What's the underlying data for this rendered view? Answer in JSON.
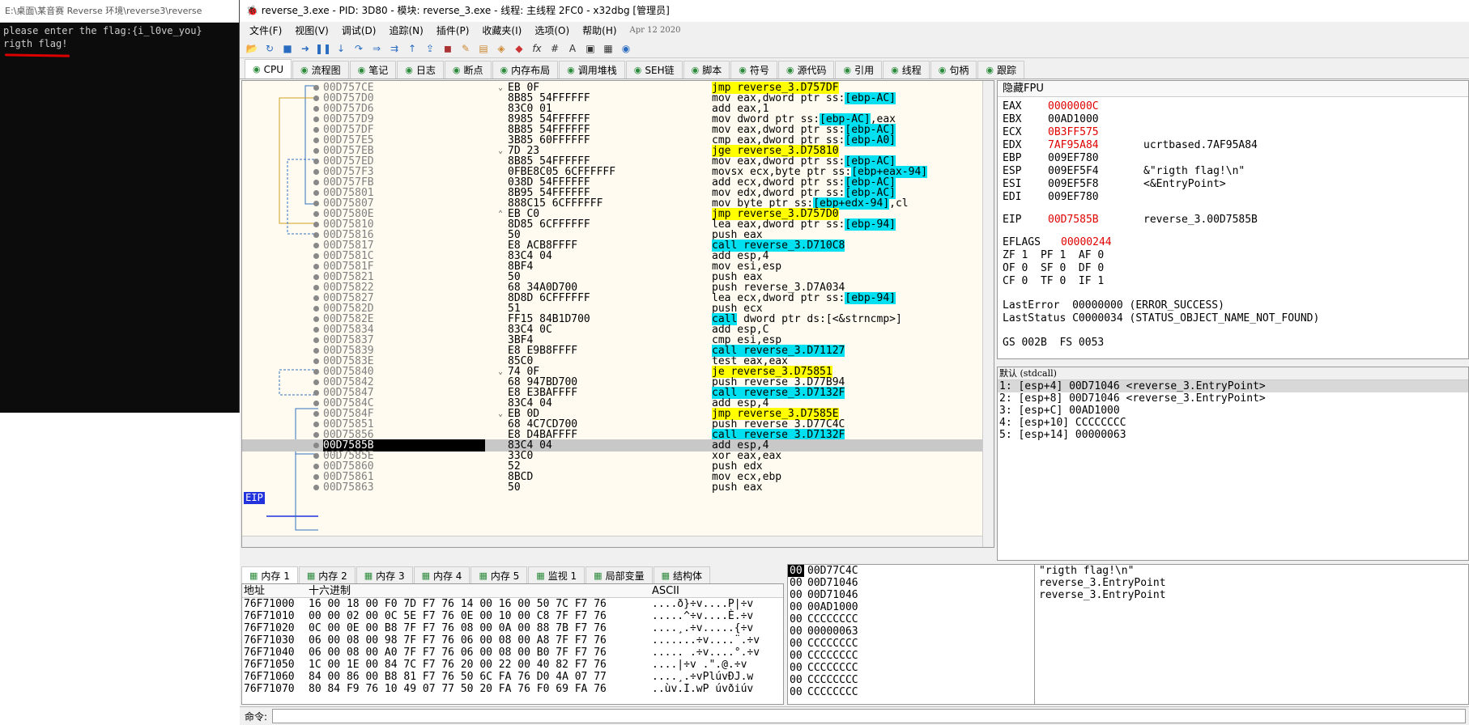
{
  "console": {
    "title": "E:\\桌面\\某音赛 Reverse 环境\\reverse3\\reverse",
    "lines": [
      "please enter the flag:{i_l0ve_you}",
      "rigth flag!"
    ]
  },
  "window": {
    "title": "reverse_3.exe - PID: 3D80 - 模块: reverse_3.exe - 线程: 主线程 2FC0 - x32dbg [管理员]"
  },
  "menu": {
    "items": [
      "文件(F)",
      "视图(V)",
      "调试(D)",
      "追踪(N)",
      "插件(P)",
      "收藏夹(I)",
      "选项(O)",
      "帮助(H)"
    ],
    "date": "Apr 12 2020"
  },
  "tabs": [
    {
      "label": "CPU",
      "icon": "cpu-icon",
      "active": true
    },
    {
      "label": "流程图",
      "icon": "graph-icon"
    },
    {
      "label": "笔记",
      "icon": "notes-icon"
    },
    {
      "label": "日志",
      "icon": "log-icon"
    },
    {
      "label": "断点",
      "icon": "breakpoint-icon"
    },
    {
      "label": "内存布局",
      "icon": "memory-map-icon"
    },
    {
      "label": "调用堆栈",
      "icon": "callstack-icon"
    },
    {
      "label": "SEH链",
      "icon": "seh-icon"
    },
    {
      "label": "脚本",
      "icon": "script-icon"
    },
    {
      "label": "符号",
      "icon": "symbol-icon"
    },
    {
      "label": "源代码",
      "icon": "source-icon"
    },
    {
      "label": "引用",
      "icon": "references-icon"
    },
    {
      "label": "线程",
      "icon": "threads-icon"
    },
    {
      "label": "句柄",
      "icon": "handles-icon"
    },
    {
      "label": "跟踪",
      "icon": "trace-icon"
    }
  ],
  "disasm": {
    "eip_label": "EIP",
    "rows": [
      {
        "addr": "00D757CE",
        "mark": "⌄",
        "bytes": "EB 0F",
        "pre": "",
        "hl": "jmp reverse_3.D757DF",
        "hlc": "hl",
        "post": ""
      },
      {
        "addr": "00D757D0",
        "bytes": "8B85 54FFFFFF",
        "pre": "mov eax,dword ptr ss:",
        "hl": "[ebp-AC]",
        "hlc": "hc",
        "post": ""
      },
      {
        "addr": "00D757D6",
        "bytes": "83C0 01",
        "pre": "add eax,1",
        "hl": "",
        "post": ""
      },
      {
        "addr": "00D757D9",
        "bytes": "8985 54FFFFFF",
        "pre": "mov dword ptr ss:",
        "hl": "[ebp-AC]",
        "hlc": "hc",
        "post": ",eax"
      },
      {
        "addr": "00D757DF",
        "bytes": "8B85 54FFFFFF",
        "pre": "mov eax,dword ptr ss:",
        "hl": "[ebp-AC]",
        "hlc": "hc",
        "post": ""
      },
      {
        "addr": "00D757E5",
        "bytes": "3B85 60FFFFFF",
        "pre": "cmp eax,dword ptr ss:",
        "hl": "[ebp-A0]",
        "hlc": "hc",
        "post": ""
      },
      {
        "addr": "00D757EB",
        "mark": "⌄",
        "bytes": "7D 23",
        "pre": "",
        "hl": "jge reverse_3.D75810",
        "hlc": "hl",
        "post": ""
      },
      {
        "addr": "00D757ED",
        "bytes": "8B85 54FFFFFF",
        "pre": "mov eax,dword ptr ss:",
        "hl": "[ebp-AC]",
        "hlc": "hc",
        "post": ""
      },
      {
        "addr": "00D757F3",
        "bytes": "0FBE8C05 6CFFFFFF",
        "pre": "movsx ecx,byte ptr ss:",
        "hl": "[ebp+eax-94]",
        "hlc": "hc",
        "post": ""
      },
      {
        "addr": "00D757FB",
        "bytes": "038D 54FFFFFF",
        "pre": "add ecx,dword ptr ss:",
        "hl": "[ebp-AC]",
        "hlc": "hc",
        "post": ""
      },
      {
        "addr": "00D75801",
        "bytes": "8B95 54FFFFFF",
        "pre": "mov edx,dword ptr ss:",
        "hl": "[ebp-AC]",
        "hlc": "hc",
        "post": ""
      },
      {
        "addr": "00D75807",
        "bytes": "888C15 6CFFFFFF",
        "pre": "mov byte ptr ss:",
        "hl": "[ebp+edx-94]",
        "hlc": "hc",
        "post": ",cl"
      },
      {
        "addr": "00D7580E",
        "mark": "⌃",
        "bytes": "EB C0",
        "pre": "",
        "hl": "jmp reverse_3.D757D0",
        "hlc": "hl",
        "post": ""
      },
      {
        "addr": "00D75810",
        "bytes": "8D85 6CFFFFFF",
        "pre": "lea eax,dword ptr ss:",
        "hl": "[ebp-94]",
        "hlc": "hc",
        "post": ""
      },
      {
        "addr": "00D75816",
        "bytes": "50",
        "pre": "push eax",
        "hl": "",
        "post": ""
      },
      {
        "addr": "00D75817",
        "bytes": "E8 ACB8FFFF",
        "pre": "",
        "hl": "call reverse_3.D710C8",
        "hlc": "hc2",
        "post": ""
      },
      {
        "addr": "00D7581C",
        "bytes": "83C4 04",
        "pre": "add esp,4",
        "hl": "",
        "post": ""
      },
      {
        "addr": "00D7581F",
        "bytes": "8BF4",
        "pre": "mov esi,esp",
        "hl": "",
        "post": ""
      },
      {
        "addr": "00D75821",
        "bytes": "50",
        "pre": "push eax",
        "hl": "",
        "post": ""
      },
      {
        "addr": "00D75822",
        "bytes": "68 34A0D700",
        "pre": "push reverse_3.D7A034",
        "hl": "",
        "post": ""
      },
      {
        "addr": "00D75827",
        "bytes": "8D8D 6CFFFFFF",
        "pre": "lea ecx,dword ptr ss:",
        "hl": "[ebp-94]",
        "hlc": "hc",
        "post": ""
      },
      {
        "addr": "00D7582D",
        "bytes": "51",
        "pre": "push ecx",
        "hl": "",
        "post": ""
      },
      {
        "addr": "00D7582E",
        "bytes": "FF15 84B1D700",
        "pre": "",
        "hl": "call",
        "hlc": "hc",
        "post": " dword ptr ds:[<&strncmp>]"
      },
      {
        "addr": "00D75834",
        "bytes": "83C4 0C",
        "pre": "add esp,C",
        "hl": "",
        "post": ""
      },
      {
        "addr": "00D75837",
        "bytes": "3BF4",
        "pre": "cmp esi,esp",
        "hl": "",
        "post": ""
      },
      {
        "addr": "00D75839",
        "bytes": "E8 E9B8FFFF",
        "pre": "",
        "hl": "call reverse_3.D71127",
        "hlc": "hc2",
        "post": ""
      },
      {
        "addr": "00D7583E",
        "bytes": "85C0",
        "pre": "test eax,eax",
        "hl": "",
        "post": ""
      },
      {
        "addr": "00D75840",
        "mark": "⌄",
        "bytes": "74 0F",
        "pre": "",
        "hl": "je reverse_3.D75851",
        "hlc": "hl",
        "post": ""
      },
      {
        "addr": "00D75842",
        "bytes": "68 947BD700",
        "pre": "push reverse_3.D77B94",
        "hl": "",
        "post": ""
      },
      {
        "addr": "00D75847",
        "bytes": "E8 E3BAFFFF",
        "pre": "",
        "hl": "call reverse_3.D7132F",
        "hlc": "hc2",
        "post": ""
      },
      {
        "addr": "00D7584C",
        "bytes": "83C4 04",
        "pre": "add esp,4",
        "hl": "",
        "post": ""
      },
      {
        "addr": "00D7584F",
        "mark": "⌄",
        "bytes": "EB 0D",
        "pre": "",
        "hl": "jmp reverse_3.D7585E",
        "hlc": "hl",
        "post": ""
      },
      {
        "addr": "00D75851",
        "bytes": "68 4C7CD700",
        "pre": "push reverse_3.D77C4C",
        "hl": "",
        "post": ""
      },
      {
        "addr": "00D75856",
        "bytes": "E8 D4BAFFFF",
        "pre": "",
        "hl": "call reverse_3.D7132F",
        "hlc": "hc2",
        "post": ""
      },
      {
        "addr": "00D7585B",
        "bytes": "83C4 04",
        "pre": "add esp,4",
        "hl": "",
        "post": "",
        "eip": true
      },
      {
        "addr": "00D7585E",
        "bytes": "33C0",
        "pre": "xor eax,eax",
        "hl": "",
        "post": ""
      },
      {
        "addr": "00D75860",
        "bytes": "52",
        "pre": "push edx",
        "hl": "",
        "post": ""
      },
      {
        "addr": "00D75861",
        "bytes": "8BCD",
        "pre": "mov ecx,ebp",
        "hl": "",
        "post": ""
      },
      {
        "addr": "00D75863",
        "bytes": "50",
        "pre": "push eax",
        "hl": "",
        "post": ""
      }
    ]
  },
  "registers": {
    "header": "隐藏FPU",
    "gp": [
      {
        "name": "EAX",
        "value": "0000000C",
        "changed": true,
        "comment": ""
      },
      {
        "name": "EBX",
        "value": "00AD1000",
        "changed": false,
        "comment": ""
      },
      {
        "name": "ECX",
        "value": "0B3FF575",
        "changed": true,
        "comment": ""
      },
      {
        "name": "EDX",
        "value": "7AF95A84",
        "changed": true,
        "comment": "ucrtbased.7AF95A84"
      },
      {
        "name": "EBP",
        "value": "009EF780",
        "changed": false,
        "comment": ""
      },
      {
        "name": "ESP",
        "value": "009EF5F4",
        "changed": false,
        "comment": "&\"rigth flag!\\n\""
      },
      {
        "name": "ESI",
        "value": "009EF5F8",
        "changed": false,
        "comment": "<&EntryPoint>"
      },
      {
        "name": "EDI",
        "value": "009EF780",
        "changed": false,
        "comment": ""
      }
    ],
    "eip": {
      "name": "EIP",
      "value": "00D7585B",
      "comment": "reverse_3.00D7585B"
    },
    "eflags": {
      "name": "EFLAGS",
      "value": "00000244"
    },
    "flags_rows": [
      "ZF 1  PF 1  AF 0",
      "OF 0  SF 0  DF 0",
      "CF 0  TF 0  IF 1"
    ],
    "last_error": "LastError  00000000 (ERROR_SUCCESS)",
    "last_status": "LastStatus C0000034 (STATUS_OBJECT_NAME_NOT_FOUND)",
    "segs": "GS 002B  FS 0053"
  },
  "args": {
    "header": "默认 (stdcall)",
    "rows": [
      "1: [esp+4] 00D71046 <reverse_3.EntryPoint>",
      "2: [esp+8] 00D71046 <reverse_3.EntryPoint>",
      "3: [esp+C] 00AD1000",
      "4: [esp+10] CCCCCCCC",
      "5: [esp+14] 00000063"
    ]
  },
  "dump_tabs": [
    {
      "label": "内存 1",
      "icon": "memory-icon",
      "active": true
    },
    {
      "label": "内存 2",
      "icon": "memory-icon"
    },
    {
      "label": "内存 3",
      "icon": "memory-icon"
    },
    {
      "label": "内存 4",
      "icon": "memory-icon"
    },
    {
      "label": "内存 5",
      "icon": "memory-icon"
    },
    {
      "label": "监视 1",
      "icon": "watch-icon"
    },
    {
      "label": "局部变量",
      "icon": "locals-icon"
    },
    {
      "label": "结构体",
      "icon": "struct-icon"
    }
  ],
  "dump": {
    "col_addr": "地址",
    "col_hex": "十六进制",
    "col_ascii": "ASCII",
    "rows": [
      {
        "addr": "76F71000",
        "hex": "16 00 18 00 F0 7D F7 76 14 00 16 00 50 7C F7 76",
        "ascii": "....ð}÷v....P|÷v"
      },
      {
        "addr": "76F71010",
        "hex": "00 00 02 00 0C 5E F7 76 0E 00 10 00 C8 7F F7 76",
        "ascii": ".....^÷v....È.÷v"
      },
      {
        "addr": "76F71020",
        "hex": "0C 00 0E 00 B8 7F F7 76 08 00 0A 00 88 7B F7 76",
        "ascii": "....¸.÷v.....{÷v"
      },
      {
        "addr": "76F71030",
        "hex": "06 00 08 00 98 7F F7 76 06 00 08 00 A8 7F F7 76",
        "ascii": ".......÷v....¨.÷v"
      },
      {
        "addr": "76F71040",
        "hex": "06 00 08 00 A0 7F F7 76 06 00 08 00 B0 7F F7 76",
        "ascii": "..... .÷v....°.÷v"
      },
      {
        "addr": "76F71050",
        "hex": "1C 00 1E 00 84 7C F7 76 20 00 22 00 40 82 F7 76",
        "ascii": "....|÷v .\".@.÷v"
      },
      {
        "addr": "76F71060",
        "hex": "84 00 86 00 B8 81 F7 76 50 6C FA 76 D0 4A 07 77",
        "ascii": "....¸.÷vPlúvÐJ.w"
      },
      {
        "addr": "76F71070",
        "hex": "80 84 F9 76 10 49 07 77 50 20 FA 76 F0 69 FA 76",
        "ascii": "..ùv.I.wP úvðiúv"
      }
    ]
  },
  "stack": {
    "rows": [
      {
        "col": "00",
        "value": "00D77C4C",
        "comment": "\"rigth flag!\\n\"",
        "top": true
      },
      {
        "col": "00",
        "value": "00D71046",
        "comment": "reverse_3.EntryPoint"
      },
      {
        "col": "00",
        "value": "00D71046",
        "comment": "reverse_3.EntryPoint"
      },
      {
        "col": "00",
        "value": "00AD1000",
        "comment": ""
      },
      {
        "col": "00",
        "value": "CCCCCCCC",
        "comment": ""
      },
      {
        "col": "00",
        "value": "00000063",
        "comment": ""
      },
      {
        "col": "00",
        "value": "CCCCCCCC",
        "comment": ""
      },
      {
        "col": "00",
        "value": "CCCCCCCC",
        "comment": ""
      },
      {
        "col": "00",
        "value": "CCCCCCCC",
        "comment": ""
      },
      {
        "col": "00",
        "value": "CCCCCCCC",
        "comment": ""
      },
      {
        "col": "00",
        "value": "CCCCCCCC",
        "comment": ""
      }
    ]
  },
  "command": {
    "label": "命令:"
  }
}
